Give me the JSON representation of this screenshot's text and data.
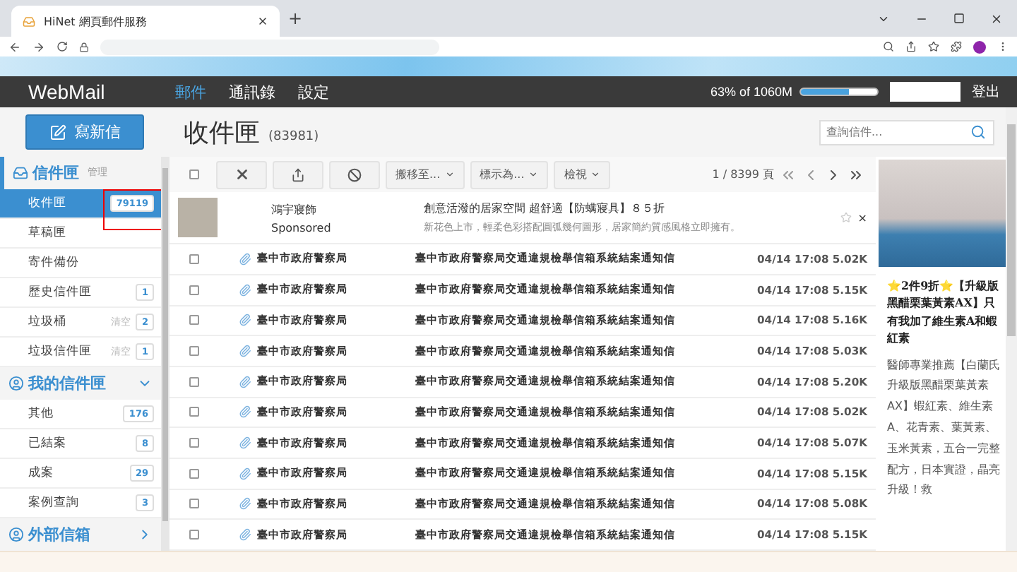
{
  "browser": {
    "tab_title": "HiNet 網頁郵件服務",
    "new_tab": "+"
  },
  "nav": {
    "logo": "WebMail",
    "items": [
      {
        "label": "郵件",
        "selected": true
      },
      {
        "label": "通訊錄",
        "selected": false
      },
      {
        "label": "設定",
        "selected": false
      }
    ],
    "quota": {
      "reading": "63% of 1060M",
      "level": 0.63
    },
    "logout": "登出"
  },
  "compose": {
    "label": "寫新信"
  },
  "header": {
    "title": "收件匣",
    "count": "(83981)",
    "search": {
      "placeholder": "查詢信件..."
    }
  },
  "sidebar": {
    "sections": [
      {
        "title": "信件匣",
        "action": "管理",
        "expanded": true,
        "items": [
          {
            "label": "收件匣",
            "count": "79119",
            "selected": true,
            "highlighted": true
          },
          {
            "label": "草稿匣",
            "selected": false
          },
          {
            "label": "寄件備份",
            "selected": false
          },
          {
            "label": "歷史信件匣",
            "count": "1",
            "selected": false
          },
          {
            "label": "垃圾桶",
            "action": "清空",
            "count": "2",
            "selected": false
          },
          {
            "label": "垃圾信件匣",
            "action": "清空",
            "count": "1",
            "selected": false
          }
        ]
      },
      {
        "title": "我的信件匣",
        "expanded": true,
        "items": [
          {
            "label": "其他",
            "count": "176",
            "selected": false
          },
          {
            "label": "已結案",
            "count": "8",
            "selected": false
          },
          {
            "label": "成案",
            "count": "29",
            "selected": false
          },
          {
            "label": "案例查詢",
            "count": "3",
            "selected": false
          }
        ]
      },
      {
        "title": "外部信箱",
        "expanded": false
      }
    ]
  },
  "toolbar": {
    "select_all": {
      "checked": false
    },
    "menus": [
      "搬移至...",
      "標示為...",
      "檢視"
    ],
    "pagination": "1 / 8399 頁"
  },
  "ad_row": {
    "advertiser": "鴻宇寢飾",
    "label": "Sponsored",
    "title": "創意活潑的居家空間 超舒適【防螨寢具】８５折",
    "body": "新花色上市，輕柔色彩搭配圓弧幾何圖形，居家簡約質感風格立即擁有。",
    "close": "×"
  },
  "messages": [
    {
      "checked": false,
      "unread": true,
      "sender": "臺中市政府警察局",
      "subject": "臺中市政府警察局交通違規檢舉信箱系統結案通知信",
      "date": "04/14 17:08",
      "size": "5.02K"
    },
    {
      "checked": false,
      "unread": true,
      "sender": "臺中市政府警察局",
      "subject": "臺中市政府警察局交通違規檢舉信箱系統結案通知信",
      "date": "04/14 17:08",
      "size": "5.15K"
    },
    {
      "checked": false,
      "unread": true,
      "sender": "臺中市政府警察局",
      "subject": "臺中市政府警察局交通違規檢舉信箱系統結案通知信",
      "date": "04/14 17:08",
      "size": "5.16K"
    },
    {
      "checked": false,
      "unread": true,
      "sender": "臺中市政府警察局",
      "subject": "臺中市政府警察局交通違規檢舉信箱系統結案通知信",
      "date": "04/14 17:08",
      "size": "5.03K"
    },
    {
      "checked": false,
      "unread": true,
      "sender": "臺中市政府警察局",
      "subject": "臺中市政府警察局交通違規檢舉信箱系統結案通知信",
      "date": "04/14 17:08",
      "size": "5.20K"
    },
    {
      "checked": false,
      "unread": true,
      "sender": "臺中市政府警察局",
      "subject": "臺中市政府警察局交通違規檢舉信箱系統結案通知信",
      "date": "04/14 17:08",
      "size": "5.02K"
    },
    {
      "checked": false,
      "unread": true,
      "sender": "臺中市政府警察局",
      "subject": "臺中市政府警察局交通違規檢舉信箱系統結案通知信",
      "date": "04/14 17:08",
      "size": "5.07K"
    },
    {
      "checked": false,
      "unread": true,
      "sender": "臺中市政府警察局",
      "subject": "臺中市政府警察局交通違規檢舉信箱系統結案通知信",
      "date": "04/14 17:08",
      "size": "5.15K"
    },
    {
      "checked": false,
      "unread": true,
      "sender": "臺中市政府警察局",
      "subject": "臺中市政府警察局交通違規檢舉信箱系統結案通知信",
      "date": "04/14 17:08",
      "size": "5.08K"
    },
    {
      "checked": false,
      "unread": true,
      "sender": "臺中市政府警察局",
      "subject": "臺中市政府警察局交通違規檢舉信箱系統結案通知信",
      "date": "04/14 17:08",
      "size": "5.15K"
    }
  ],
  "side_ad": {
    "title": "⭐2件9折⭐【升級版黑醋栗葉黃素AX】只有我加了維生素A和蝦紅素",
    "body": "醫師專業推薦【白蘭氏升級版黑醋栗葉黃素AX】蝦紅素、維生素A、花青素、葉黃素、玉米黃素，五合一完整配方，日本實證，晶亮升級！救"
  }
}
